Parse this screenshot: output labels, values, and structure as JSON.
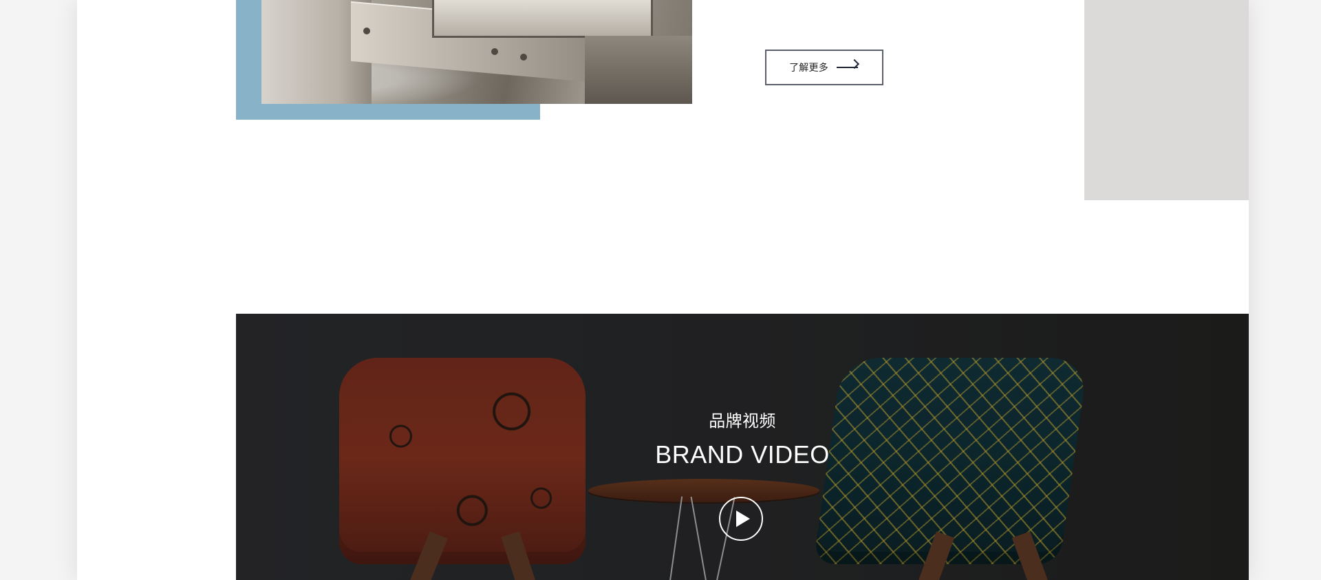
{
  "about": {
    "more_label": "了解更多",
    "arrow_icon": "arrow-right-icon",
    "accent_color": "#88b2c8",
    "panel_color": "#dcdad8"
  },
  "brand_video": {
    "title_cn": "品牌视频",
    "title_en": "BRAND VIDEO",
    "play_icon": "play-icon"
  }
}
